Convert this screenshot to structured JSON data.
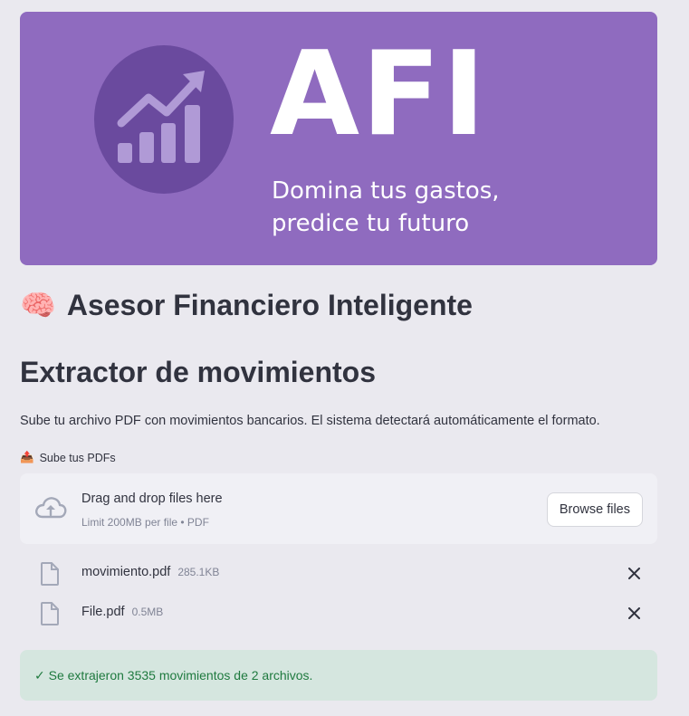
{
  "banner": {
    "brand": "AFI",
    "tagline_line1": "Domina tus gastos,",
    "tagline_line2": "predice tu futuro",
    "logo_icon": "chart-up-icon",
    "colors": {
      "background": "#8f6bbf",
      "circle": "#6a4a9e",
      "bars": "#b09ad6"
    }
  },
  "header": {
    "emoji": "🧠",
    "title": "Asesor Financiero Inteligente"
  },
  "section": {
    "title": "Extractor de movimientos",
    "description": "Sube tu archivo PDF con movimientos bancarios. El sistema detectará automáticamente el formato."
  },
  "uploader": {
    "label_icon": "📤",
    "label": "Sube tus PDFs",
    "drop_title": "Drag and drop files here",
    "limit_text": "Limit 200MB per file • PDF",
    "browse_label": "Browse files",
    "cloud_icon": "cloud-upload-icon",
    "files": [
      {
        "name": "movimiento.pdf",
        "size": "285.1KB"
      },
      {
        "name": "File.pdf",
        "size": "0.5MB"
      }
    ]
  },
  "success": {
    "icon": "✓",
    "message": "Se extrajeron 3535 movimientos de 2 archivos.",
    "color": "#1f7a3f"
  }
}
